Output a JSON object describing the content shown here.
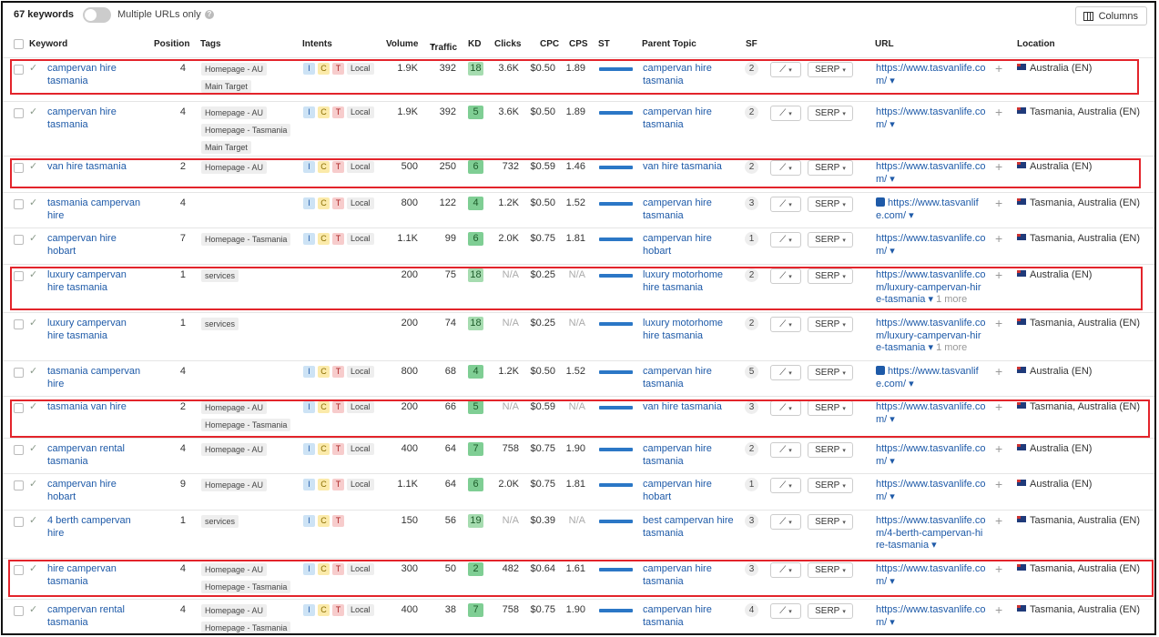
{
  "toolbar": {
    "keyword_count": "67 keywords",
    "multiple_urls_label": "Multiple URLs only",
    "columns_label": "Columns"
  },
  "columns": {
    "keyword": "Keyword",
    "position": "Position",
    "tags": "Tags",
    "intents": "Intents",
    "volume": "Volume",
    "traffic": "Traffic",
    "kd": "KD",
    "clicks": "Clicks",
    "cpc": "CPC",
    "cps": "CPS",
    "st": "ST",
    "parent_topic": "Parent Topic",
    "sf": "SF",
    "url": "URL",
    "location": "Location"
  },
  "labels": {
    "serp": "SERP",
    "local": "Local",
    "i": "I",
    "c": "C",
    "t": "T",
    "na": "N/A"
  },
  "rows": [
    {
      "kw1": "campervan hire",
      "kw2": "tasmania",
      "pos": "4",
      "tags": [
        "Homepage - AU",
        "Main Target"
      ],
      "local": true,
      "ict": true,
      "vol": "1.9K",
      "traffic": "392",
      "kd": "18",
      "clicks": "3.6K",
      "cpc": "$0.50",
      "cps": "1.89",
      "pt1": "campervan hire",
      "pt2": "tasmania",
      "sf": "2",
      "url": [
        "https://www.tasvanlife.co",
        "m/ ▾"
      ],
      "url_img": false,
      "loc": "Australia (EN)",
      "hl": true
    },
    {
      "kw1": "campervan hire",
      "kw2": "tasmania",
      "pos": "4",
      "tags": [
        "Homepage - AU",
        "Homepage - Tasmania",
        "Main Target"
      ],
      "local": true,
      "ict": true,
      "vol": "1.9K",
      "traffic": "392",
      "kd": "5",
      "clicks": "3.6K",
      "cpc": "$0.50",
      "cps": "1.89",
      "pt1": "campervan hire",
      "pt2": "tasmania",
      "sf": "2",
      "url": [
        "https://www.tasvanlife.co",
        "m/ ▾"
      ],
      "url_img": false,
      "loc": "Tasmania, Australia (EN)",
      "hl": false
    },
    {
      "kw1": "van hire tasmania",
      "kw2": "",
      "pos": "2",
      "tags": [
        "Homepage - AU"
      ],
      "local": true,
      "ict": true,
      "vol": "500",
      "traffic": "250",
      "kd": "6",
      "clicks": "732",
      "cpc": "$0.59",
      "cps": "1.46",
      "pt1": "van hire tasmania",
      "pt2": "",
      "sf": "2",
      "url": [
        "https://www.tasvanlife.co",
        "m/ ▾"
      ],
      "url_img": false,
      "loc": "Australia (EN)",
      "hl": true
    },
    {
      "kw1": "tasmania campervan",
      "kw2": "hire",
      "pos": "4",
      "tags": [],
      "local": true,
      "ict": true,
      "vol": "800",
      "traffic": "122",
      "kd": "4",
      "clicks": "1.2K",
      "cpc": "$0.50",
      "cps": "1.52",
      "pt1": "campervan hire",
      "pt2": "tasmania",
      "sf": "3",
      "url": [
        "https://www.tasvanlif",
        "e.com/ ▾"
      ],
      "url_img": true,
      "loc": "Tasmania, Australia (EN)",
      "hl": false
    },
    {
      "kw1": "campervan hire",
      "kw2": "hobart",
      "pos": "7",
      "tags": [
        "Homepage - Tasmania"
      ],
      "local": true,
      "ict": true,
      "vol": "1.1K",
      "traffic": "99",
      "kd": "6",
      "clicks": "2.0K",
      "cpc": "$0.75",
      "cps": "1.81",
      "pt1": "campervan hire",
      "pt2": "hobart",
      "sf": "1",
      "url": [
        "https://www.tasvanlife.co",
        "m/ ▾"
      ],
      "url_img": false,
      "loc": "Tasmania, Australia (EN)",
      "hl": false
    },
    {
      "kw1": "luxury campervan",
      "kw2": "hire tasmania",
      "pos": "1",
      "tags": [
        "services"
      ],
      "local": false,
      "ict": false,
      "vol": "200",
      "traffic": "75",
      "kd": "18",
      "clicks": "N/A",
      "cpc": "$0.25",
      "cps": "N/A",
      "pt1": "luxury motorhome",
      "pt2": "hire tasmania",
      "sf": "2",
      "url": [
        "https://www.tasvanlife.co",
        "m/luxury-campervan-hir",
        "e-tasmania ▾"
      ],
      "more": "1 more",
      "url_img": false,
      "loc": "Australia (EN)",
      "hl": true
    },
    {
      "kw1": "luxury campervan",
      "kw2": "hire tasmania",
      "pos": "1",
      "tags": [
        "services"
      ],
      "local": false,
      "ict": false,
      "vol": "200",
      "traffic": "74",
      "kd": "18",
      "clicks": "N/A",
      "cpc": "$0.25",
      "cps": "N/A",
      "pt1": "luxury motorhome",
      "pt2": "hire tasmania",
      "sf": "2",
      "url": [
        "https://www.tasvanlife.co",
        "m/luxury-campervan-hir",
        "e-tasmania ▾"
      ],
      "more": "1 more",
      "url_img": false,
      "loc": "Tasmania, Australia (EN)",
      "hl": false
    },
    {
      "kw1": "tasmania campervan",
      "kw2": "hire",
      "pos": "4",
      "tags": [],
      "local": true,
      "ict": true,
      "vol": "800",
      "traffic": "68",
      "kd": "4",
      "clicks": "1.2K",
      "cpc": "$0.50",
      "cps": "1.52",
      "pt1": "campervan hire",
      "pt2": "tasmania",
      "sf": "5",
      "url": [
        "https://www.tasvanlif",
        "e.com/ ▾"
      ],
      "url_img": true,
      "loc": "Australia (EN)",
      "hl": false
    },
    {
      "kw1": "tasmania van hire",
      "kw2": "",
      "pos": "2",
      "tags": [
        "Homepage - AU",
        "Homepage - Tasmania"
      ],
      "local": true,
      "ict": true,
      "vol": "200",
      "traffic": "66",
      "kd": "5",
      "clicks": "N/A",
      "cpc": "$0.59",
      "cps": "N/A",
      "pt1": "van hire tasmania",
      "pt2": "",
      "sf": "3",
      "url": [
        "https://www.tasvanlife.co",
        "m/ ▾"
      ],
      "url_img": false,
      "loc": "Tasmania, Australia (EN)",
      "hl": true
    },
    {
      "kw1": "campervan rental",
      "kw2": "tasmania",
      "pos": "4",
      "tags": [
        "Homepage - AU"
      ],
      "local": true,
      "ict": true,
      "vol": "400",
      "traffic": "64",
      "kd": "7",
      "clicks": "758",
      "cpc": "$0.75",
      "cps": "1.90",
      "pt1": "campervan hire",
      "pt2": "tasmania",
      "sf": "2",
      "url": [
        "https://www.tasvanlife.co",
        "m/ ▾"
      ],
      "url_img": false,
      "loc": "Australia (EN)",
      "hl": false
    },
    {
      "kw1": "campervan hire",
      "kw2": "hobart",
      "pos": "9",
      "tags": [
        "Homepage - AU"
      ],
      "local": true,
      "ict": true,
      "vol": "1.1K",
      "traffic": "64",
      "kd": "6",
      "clicks": "2.0K",
      "cpc": "$0.75",
      "cps": "1.81",
      "pt1": "campervan hire",
      "pt2": "hobart",
      "sf": "1",
      "url": [
        "https://www.tasvanlife.co",
        "m/ ▾"
      ],
      "url_img": false,
      "loc": "Australia (EN)",
      "hl": false
    },
    {
      "kw1": "4 berth campervan",
      "kw2": "hire",
      "pos": "1",
      "tags": [
        "services"
      ],
      "local": false,
      "ict": true,
      "vol": "150",
      "traffic": "56",
      "kd": "19",
      "clicks": "N/A",
      "cpc": "$0.39",
      "cps": "N/A",
      "pt1": "best campervan hire",
      "pt2": "tasmania",
      "sf": "3",
      "url": [
        "https://www.tasvanlife.co",
        "m/4-berth-campervan-hi",
        "re-tasmania ▾"
      ],
      "url_img": false,
      "loc": "Tasmania, Australia (EN)",
      "hl": false
    },
    {
      "kw1": "hire campervan",
      "kw2": "tasmania",
      "pos": "4",
      "tags": [
        "Homepage - AU",
        "Homepage - Tasmania"
      ],
      "local": true,
      "ict": true,
      "vol": "300",
      "traffic": "50",
      "kd": "2",
      "clicks": "482",
      "cpc": "$0.64",
      "cps": "1.61",
      "pt1": "campervan hire",
      "pt2": "tasmania",
      "sf": "3",
      "url": [
        "https://www.tasvanlife.co",
        "m/ ▾"
      ],
      "url_img": false,
      "loc": "Tasmania, Australia (EN)",
      "hl": true
    },
    {
      "kw1": "campervan rental",
      "kw2": "tasmania",
      "pos": "4",
      "tags": [
        "Homepage - AU",
        "Homepage - Tasmania"
      ],
      "local": true,
      "ict": true,
      "vol": "400",
      "traffic": "38",
      "kd": "7",
      "clicks": "758",
      "cpc": "$0.75",
      "cps": "1.90",
      "pt1": "campervan hire",
      "pt2": "tasmania",
      "sf": "4",
      "url": [
        "https://www.tasvanlife.co",
        "m/ ▾"
      ],
      "url_img": false,
      "loc": "Tasmania, Australia (EN)",
      "hl": false
    }
  ]
}
